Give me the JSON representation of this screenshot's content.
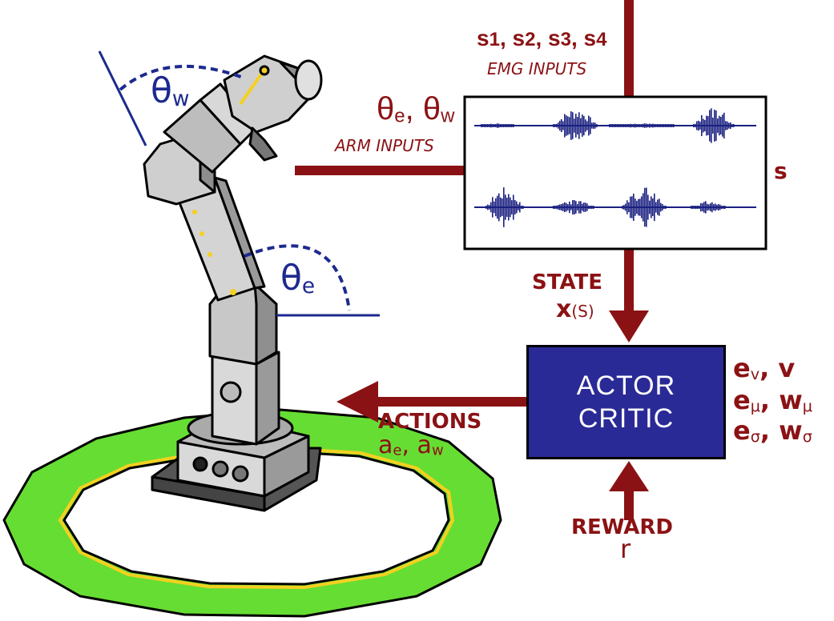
{
  "emg_inputs": {
    "symbols": [
      "s",
      "s",
      "s",
      "s"
    ],
    "indices": [
      "1",
      "2",
      "3",
      "4"
    ],
    "label": "EMG INPUTS"
  },
  "arm_inputs": {
    "theta": "θ",
    "subs": [
      "e",
      "w"
    ],
    "label": "ARM INPUTS"
  },
  "signal_label": "s",
  "state": {
    "label": "STATE",
    "symbol": "x",
    "arg": "(S)"
  },
  "actor_critic": {
    "line1": "ACTOR",
    "line2": "CRITIC"
  },
  "params": {
    "row1": {
      "e": "e",
      "e_sub": "v",
      "w": "v",
      "w_sub": ""
    },
    "row2": {
      "e": "e",
      "e_sub": "μ",
      "w": "w",
      "w_sub": "μ"
    },
    "row3": {
      "e": "e",
      "e_sub": "σ",
      "w": "w",
      "w_sub": "σ"
    }
  },
  "actions": {
    "label": "ACTIONS",
    "a": "a",
    "subs": [
      "e",
      "w"
    ]
  },
  "reward": {
    "label": "REWARD",
    "symbol": "r"
  },
  "angles": {
    "wrist": {
      "theta": "θ",
      "sub": "w"
    },
    "elbow": {
      "theta": "θ",
      "sub": "e"
    }
  },
  "colors": {
    "flow_red": "#8b1214",
    "angle_blue": "#1c2a8e",
    "box_fill": "#2a2a96",
    "ring_green": "#66dd33",
    "ring_yellow": "#f5d020",
    "signal_navy": "#1a2080"
  },
  "icons": [
    "robot-arm-illustration",
    "emg-waveform-trace",
    "green-ring-platform"
  ]
}
